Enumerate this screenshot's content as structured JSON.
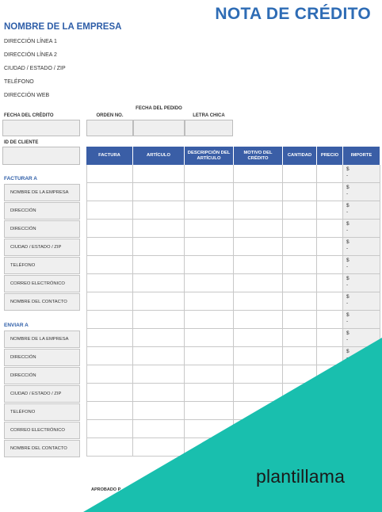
{
  "header": {
    "title": "NOTA DE CRÉDITO",
    "company_name": "NOMBRE DE LA EMPRESA",
    "address_lines": [
      "DIRECCIÓN LÍNEA 1",
      "DIRECCIÓN LÍNEA 2",
      "CIUDAD / ESTADO / ZIP",
      "TELÉFONO",
      "DIRECCIÓN WEB"
    ]
  },
  "fields": {
    "credit_date": "FECHA DEL CRÉDITO",
    "order_no": "ORDEN NO.",
    "order_date": "FECHA DEL PEDIDO",
    "fine_print": "LETRA CHICA",
    "client_id": "ID DE CLIENTE"
  },
  "bill_to": {
    "heading": "FACTURAR A",
    "items": [
      "NOMBRE DE LA EMPRESA",
      "DIRECCIÓN",
      "DIRECCIÓN",
      "CIUDAD / ESTADO / ZIP",
      "TELÉFONO",
      "CORREO ELECTRÓNICO",
      "NOMBRE DEL CONTACTO"
    ]
  },
  "ship_to": {
    "heading": "ENVIAR A",
    "items": [
      "NOMBRE DE LA EMPRESA",
      "DIRECCIÓN",
      "DIRECCIÓN",
      "CIUDAD / ESTADO / ZIP",
      "TELÉFONO",
      "CORREO ELECTRÓNICO",
      "NOMBRE DEL CONTACTO"
    ]
  },
  "table": {
    "columns": [
      "FACTURA",
      "ARTÍCULO",
      "DESCRIPCIÓN DEL ARTÍCULO",
      "MOTIVO DEL CRÉDITO",
      "CANTIDAD",
      "PRECIO",
      "IMPORTE"
    ],
    "currency_symbol": "$",
    "empty_amount": "-",
    "row_count": 16
  },
  "footer": {
    "approved_by": "APROBADO P"
  },
  "brand": {
    "name": "plantillama",
    "accent_color": "#19bfae"
  }
}
